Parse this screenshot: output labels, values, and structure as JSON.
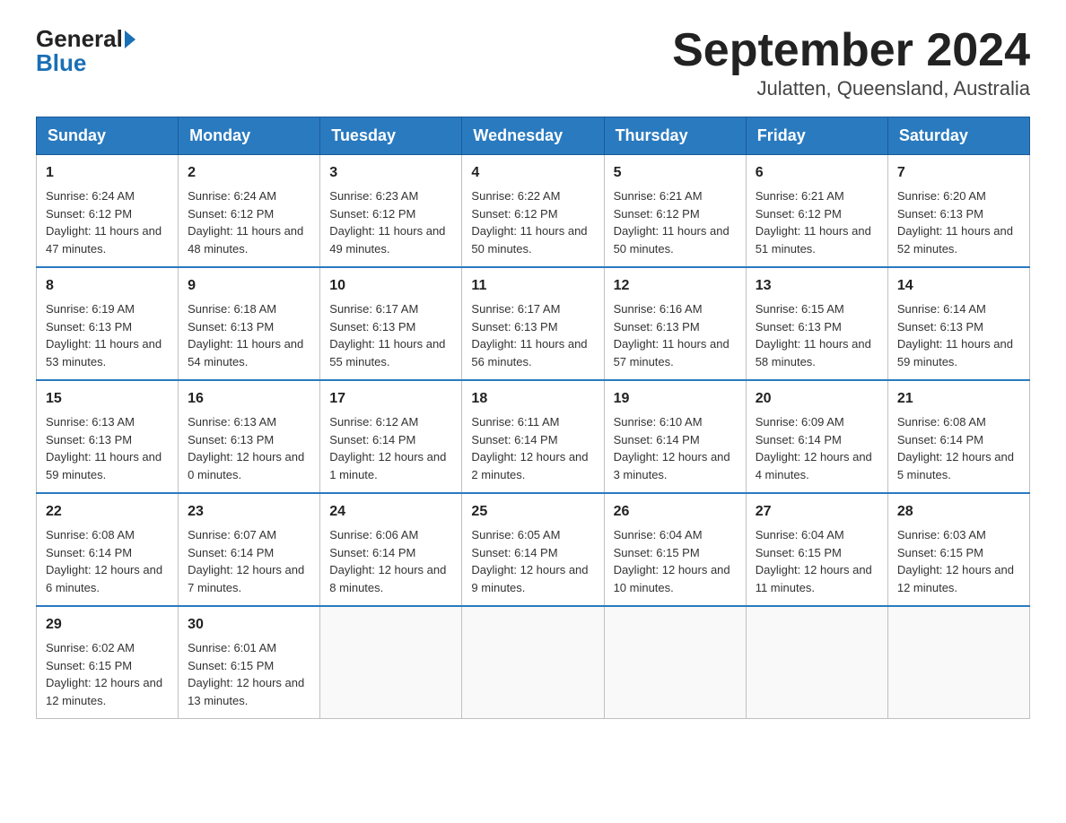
{
  "logo": {
    "general": "General",
    "blue": "Blue",
    "arrow_color": "#1a6fb5"
  },
  "title": "September 2024",
  "location": "Julatten, Queensland, Australia",
  "weekdays": [
    "Sunday",
    "Monday",
    "Tuesday",
    "Wednesday",
    "Thursday",
    "Friday",
    "Saturday"
  ],
  "weeks": [
    [
      {
        "day": "1",
        "sunrise": "6:24 AM",
        "sunset": "6:12 PM",
        "daylight": "11 hours and 47 minutes."
      },
      {
        "day": "2",
        "sunrise": "6:24 AM",
        "sunset": "6:12 PM",
        "daylight": "11 hours and 48 minutes."
      },
      {
        "day": "3",
        "sunrise": "6:23 AM",
        "sunset": "6:12 PM",
        "daylight": "11 hours and 49 minutes."
      },
      {
        "day": "4",
        "sunrise": "6:22 AM",
        "sunset": "6:12 PM",
        "daylight": "11 hours and 50 minutes."
      },
      {
        "day": "5",
        "sunrise": "6:21 AM",
        "sunset": "6:12 PM",
        "daylight": "11 hours and 50 minutes."
      },
      {
        "day": "6",
        "sunrise": "6:21 AM",
        "sunset": "6:12 PM",
        "daylight": "11 hours and 51 minutes."
      },
      {
        "day": "7",
        "sunrise": "6:20 AM",
        "sunset": "6:13 PM",
        "daylight": "11 hours and 52 minutes."
      }
    ],
    [
      {
        "day": "8",
        "sunrise": "6:19 AM",
        "sunset": "6:13 PM",
        "daylight": "11 hours and 53 minutes."
      },
      {
        "day": "9",
        "sunrise": "6:18 AM",
        "sunset": "6:13 PM",
        "daylight": "11 hours and 54 minutes."
      },
      {
        "day": "10",
        "sunrise": "6:17 AM",
        "sunset": "6:13 PM",
        "daylight": "11 hours and 55 minutes."
      },
      {
        "day": "11",
        "sunrise": "6:17 AM",
        "sunset": "6:13 PM",
        "daylight": "11 hours and 56 minutes."
      },
      {
        "day": "12",
        "sunrise": "6:16 AM",
        "sunset": "6:13 PM",
        "daylight": "11 hours and 57 minutes."
      },
      {
        "day": "13",
        "sunrise": "6:15 AM",
        "sunset": "6:13 PM",
        "daylight": "11 hours and 58 minutes."
      },
      {
        "day": "14",
        "sunrise": "6:14 AM",
        "sunset": "6:13 PM",
        "daylight": "11 hours and 59 minutes."
      }
    ],
    [
      {
        "day": "15",
        "sunrise": "6:13 AM",
        "sunset": "6:13 PM",
        "daylight": "11 hours and 59 minutes."
      },
      {
        "day": "16",
        "sunrise": "6:13 AM",
        "sunset": "6:13 PM",
        "daylight": "12 hours and 0 minutes."
      },
      {
        "day": "17",
        "sunrise": "6:12 AM",
        "sunset": "6:14 PM",
        "daylight": "12 hours and 1 minute."
      },
      {
        "day": "18",
        "sunrise": "6:11 AM",
        "sunset": "6:14 PM",
        "daylight": "12 hours and 2 minutes."
      },
      {
        "day": "19",
        "sunrise": "6:10 AM",
        "sunset": "6:14 PM",
        "daylight": "12 hours and 3 minutes."
      },
      {
        "day": "20",
        "sunrise": "6:09 AM",
        "sunset": "6:14 PM",
        "daylight": "12 hours and 4 minutes."
      },
      {
        "day": "21",
        "sunrise": "6:08 AM",
        "sunset": "6:14 PM",
        "daylight": "12 hours and 5 minutes."
      }
    ],
    [
      {
        "day": "22",
        "sunrise": "6:08 AM",
        "sunset": "6:14 PM",
        "daylight": "12 hours and 6 minutes."
      },
      {
        "day": "23",
        "sunrise": "6:07 AM",
        "sunset": "6:14 PM",
        "daylight": "12 hours and 7 minutes."
      },
      {
        "day": "24",
        "sunrise": "6:06 AM",
        "sunset": "6:14 PM",
        "daylight": "12 hours and 8 minutes."
      },
      {
        "day": "25",
        "sunrise": "6:05 AM",
        "sunset": "6:14 PM",
        "daylight": "12 hours and 9 minutes."
      },
      {
        "day": "26",
        "sunrise": "6:04 AM",
        "sunset": "6:15 PM",
        "daylight": "12 hours and 10 minutes."
      },
      {
        "day": "27",
        "sunrise": "6:04 AM",
        "sunset": "6:15 PM",
        "daylight": "12 hours and 11 minutes."
      },
      {
        "day": "28",
        "sunrise": "6:03 AM",
        "sunset": "6:15 PM",
        "daylight": "12 hours and 12 minutes."
      }
    ],
    [
      {
        "day": "29",
        "sunrise": "6:02 AM",
        "sunset": "6:15 PM",
        "daylight": "12 hours and 12 minutes."
      },
      {
        "day": "30",
        "sunrise": "6:01 AM",
        "sunset": "6:15 PM",
        "daylight": "12 hours and 13 minutes."
      },
      null,
      null,
      null,
      null,
      null
    ]
  ],
  "labels": {
    "sunrise": "Sunrise:",
    "sunset": "Sunset:",
    "daylight": "Daylight:"
  }
}
